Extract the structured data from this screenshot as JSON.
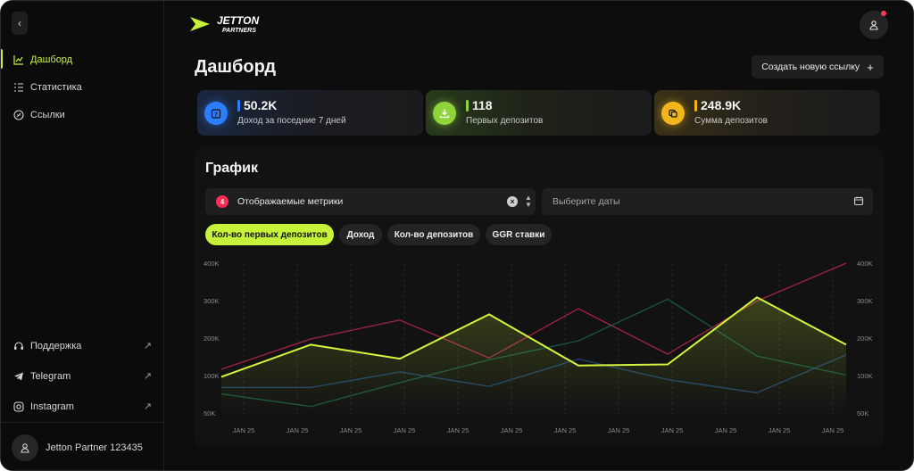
{
  "sidebar": {
    "nav": [
      {
        "label": "Дашборд",
        "icon": "chart-icon",
        "active": true
      },
      {
        "label": "Статистика",
        "icon": "list-icon",
        "active": false
      },
      {
        "label": "Ссылки",
        "icon": "link-icon",
        "active": false
      }
    ],
    "bottom": [
      {
        "label": "Поддержка",
        "icon": "headset-icon"
      },
      {
        "label": "Telegram",
        "icon": "telegram-icon"
      },
      {
        "label": "Instagram",
        "icon": "instagram-icon"
      }
    ],
    "user_name": "Jetton Partner 123435"
  },
  "header": {
    "logo_line1": "JETTON",
    "logo_line2": "PARTNERS",
    "page_title": "Дашборд",
    "create_button": "Создать новую ссылку",
    "create_button_icon": "+"
  },
  "stats": [
    {
      "value": "50.2K",
      "label": "Доход за поседние 7 дней",
      "icon": "calendar-icon",
      "color": "#2f7dff"
    },
    {
      "value": "118",
      "label": "Первых депозитов",
      "icon": "download-icon",
      "color": "#8fd33a"
    },
    {
      "value": "248.9K",
      "label": "Сумма депозитов",
      "icon": "coins-icon",
      "color": "#f2b51b"
    }
  ],
  "chart": {
    "title": "График",
    "metrics_count": "4",
    "metrics_label": "Отображаемые метрики",
    "date_placeholder": "Выберите даты",
    "chips": [
      {
        "label": "Кол-во первых депозитов",
        "active": true
      },
      {
        "label": "Доход",
        "active": false
      },
      {
        "label": "Кол-во депозитов",
        "active": false
      },
      {
        "label": "GGR ставки",
        "active": false
      }
    ]
  },
  "chart_data": {
    "type": "line",
    "x": [
      "JAN 25",
      "JAN 25",
      "JAN 25",
      "JAN 25",
      "JAN 25",
      "JAN 25",
      "JAN 25",
      "JAN 25",
      "JAN 25",
      "JAN 25",
      "JAN 25",
      "JAN 25"
    ],
    "y_ticks_left": [
      "400K",
      "300K",
      "200K",
      "100K",
      "50K"
    ],
    "y_ticks_right": [
      "400K",
      "300K",
      "200K",
      "100K",
      "50K"
    ],
    "ylim": [
      0,
      400
    ],
    "grid": "vertical-dashed",
    "series": [
      {
        "color": "#d4f53c",
        "highlighted": true,
        "values": [
          100,
          185,
          148,
          265,
          130,
          133,
          310,
          185
        ],
        "x_index": [
          0,
          2,
          4,
          6,
          8,
          10,
          12,
          14
        ]
      },
      {
        "color": "#b3264f",
        "highlighted": false,
        "values": [
          120,
          200,
          250,
          150,
          280,
          160,
          300,
          400
        ],
        "x_index": [
          0,
          2,
          4,
          6,
          8,
          10,
          12,
          14
        ]
      },
      {
        "color": "#1c5c44",
        "highlighted": false,
        "values": [
          55,
          22,
          85,
          145,
          195,
          305,
          155,
          105
        ],
        "x_index": [
          0,
          2,
          4,
          6,
          8,
          10,
          12,
          14
        ]
      },
      {
        "color": "#224a78",
        "highlighted": false,
        "values": [
          72,
          72,
          113,
          75,
          147,
          93,
          58,
          158
        ],
        "x_index": [
          0,
          2,
          4,
          6,
          8,
          10,
          12,
          14
        ]
      }
    ]
  }
}
